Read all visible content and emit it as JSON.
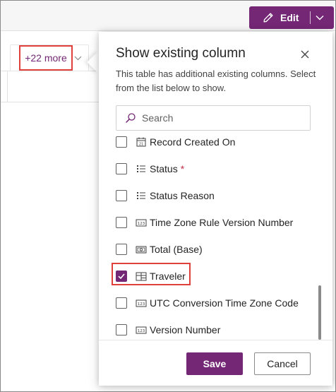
{
  "toolbar": {
    "edit_label": "Edit",
    "edit_icon": "pencil-icon",
    "edit_menu_icon": "chevron-down-icon"
  },
  "grid": {
    "more_columns_label": "+22 more",
    "more_columns_icon": "chevron-down-icon"
  },
  "panel": {
    "title": "Show existing column",
    "description": "This table has additional existing columns. Select from the list below to show.",
    "close_icon": "close-icon",
    "search": {
      "placeholder": "Search",
      "value": "",
      "icon": "search-icon"
    },
    "columns": [
      {
        "label": "Record Created On",
        "required": false,
        "checked": false,
        "icon": "date-time-icon"
      },
      {
        "label": "Status",
        "required": true,
        "checked": false,
        "icon": "choice-list-icon"
      },
      {
        "label": "Status Reason",
        "required": false,
        "checked": false,
        "icon": "choice-list-icon"
      },
      {
        "label": "Time Zone Rule Version Number",
        "required": false,
        "checked": false,
        "icon": "number-icon"
      },
      {
        "label": "Total (Base)",
        "required": false,
        "checked": false,
        "icon": "currency-icon"
      },
      {
        "label": "Traveler",
        "required": false,
        "checked": true,
        "icon": "lookup-icon"
      },
      {
        "label": "UTC Conversion Time Zone Code",
        "required": false,
        "checked": false,
        "icon": "number-icon"
      },
      {
        "label": "Version Number",
        "required": false,
        "checked": false,
        "icon": "number-icon"
      }
    ],
    "required_marker": "*",
    "save_label": "Save",
    "cancel_label": "Cancel"
  },
  "colors": {
    "accent": "#742774",
    "highlight": "#e0403b",
    "required": "#c4314b"
  }
}
